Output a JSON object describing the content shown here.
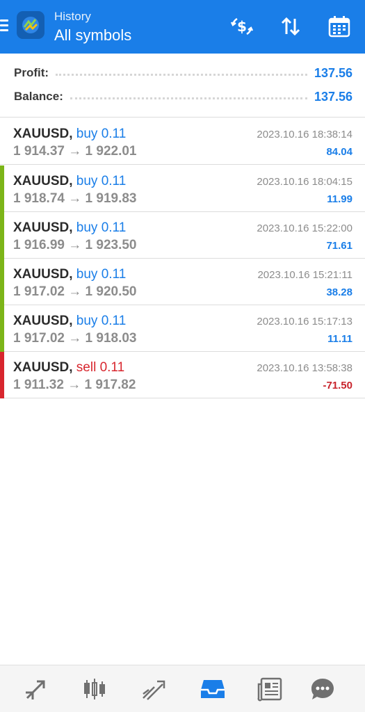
{
  "header": {
    "subtitle": "History",
    "title": "All symbols"
  },
  "summary": {
    "profit_label": "Profit:",
    "profit_value": "137.56",
    "balance_label": "Balance:",
    "balance_value": "137.56"
  },
  "trades": [
    {
      "symbol": "XAUUSD,",
      "side": "buy 0.11",
      "open": "1 914.37",
      "close": "1 922.01",
      "time": "2023.10.16 18:38:14",
      "profit": "84.04",
      "bar": "none"
    },
    {
      "symbol": "XAUUSD,",
      "side": "buy 0.11",
      "open": "1 918.74",
      "close": "1 919.83",
      "time": "2023.10.16 18:04:15",
      "profit": "11.99",
      "bar": "#7cb518"
    },
    {
      "symbol": "XAUUSD,",
      "side": "buy 0.11",
      "open": "1 916.99",
      "close": "1 923.50",
      "time": "2023.10.16 15:22:00",
      "profit": "71.61",
      "bar": "#7cb518"
    },
    {
      "symbol": "XAUUSD,",
      "side": "buy 0.11",
      "open": "1 917.02",
      "close": "1 920.50",
      "time": "2023.10.16 15:21:11",
      "profit": "38.28",
      "bar": "#7cb518"
    },
    {
      "symbol": "XAUUSD,",
      "side": "buy 0.11",
      "open": "1 917.02",
      "close": "1 918.03",
      "time": "2023.10.16 15:17:13",
      "profit": "11.11",
      "bar": "#7cb518"
    },
    {
      "symbol": "XAUUSD,",
      "side": "sell 0.11",
      "open": "1 911.32",
      "close": "1 917.82",
      "time": "2023.10.16 13:58:38",
      "profit": "-71.50",
      "bar": "#d8262e"
    }
  ],
  "arrow": "→",
  "colors": {
    "accent": "#1a7ee8",
    "buy_bar": "#7cb518",
    "sell_bar": "#d8262e",
    "negative": "#c8232b"
  },
  "bottom_nav": [
    {
      "icon": "quotes-icon",
      "active": false
    },
    {
      "icon": "chart-candles-icon",
      "active": false
    },
    {
      "icon": "trade-icon",
      "active": false
    },
    {
      "icon": "history-inbox-icon",
      "active": true
    },
    {
      "icon": "news-icon",
      "active": false
    },
    {
      "icon": "chat-icon",
      "active": false
    }
  ]
}
